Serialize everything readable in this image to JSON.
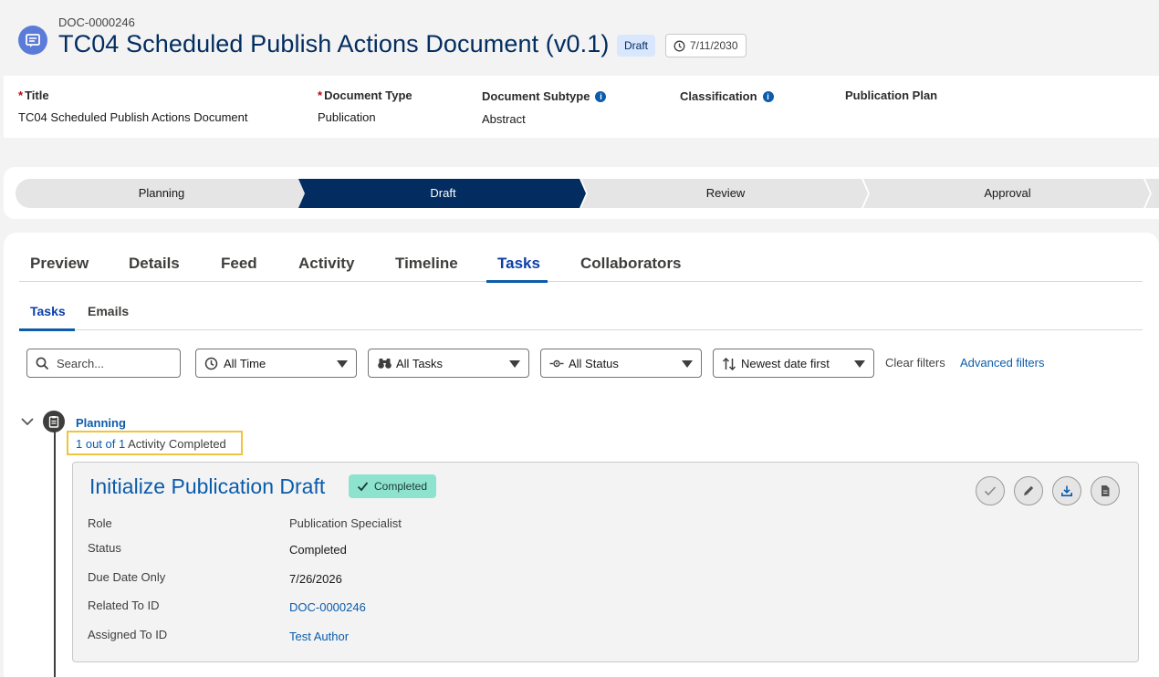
{
  "header": {
    "doc_id": "DOC-0000246",
    "title": "TC04 Scheduled Publish Actions Document (v0.1)",
    "status_badge": "Draft",
    "date_badge": "7/11/2030"
  },
  "fields": [
    {
      "label": "Title",
      "required": true,
      "value": "TC04 Scheduled Publish Actions Document",
      "info": false
    },
    {
      "label": "Document Type",
      "required": true,
      "value": "Publication",
      "info": false
    },
    {
      "label": "Document Subtype",
      "required": false,
      "value": "Abstract",
      "info": true
    },
    {
      "label": "Classification",
      "required": false,
      "value": "",
      "info": true
    },
    {
      "label": "Publication Plan",
      "required": false,
      "value": "",
      "info": false
    }
  ],
  "path": {
    "stages": [
      "Planning",
      "Draft",
      "Review",
      "Approval"
    ],
    "current": "Draft"
  },
  "tabs": {
    "items": [
      "Preview",
      "Details",
      "Feed",
      "Activity",
      "Timeline",
      "Tasks",
      "Collaborators"
    ],
    "active": "Tasks"
  },
  "subtabs": {
    "items": [
      "Tasks",
      "Emails"
    ],
    "active": "Tasks"
  },
  "filters": {
    "search_placeholder": "Search...",
    "time": "All Time",
    "type": "All Tasks",
    "status": "All Status",
    "sort": "Newest date first",
    "clear": "Clear filters",
    "advanced": "Advanced filters"
  },
  "group": {
    "title": "Planning",
    "progress_count": "1 out of 1",
    "progress_text": "Activity Completed"
  },
  "task": {
    "title": "Initialize Publication Draft",
    "status_badge": "Completed",
    "rows": [
      {
        "label": "Role",
        "value": "Publication Specialist"
      },
      {
        "label": "Status",
        "value": "Completed"
      },
      {
        "label": "Due Date Only",
        "value": "7/26/2026"
      },
      {
        "label": "Related To ID",
        "value": "DOC-0000246"
      },
      {
        "label": "Assigned To ID",
        "value": "Test Author"
      }
    ]
  },
  "colors": {
    "brand_navy": "#032d60",
    "link_blue": "#0b5cab",
    "highlight": "#f0c43b",
    "completed_green": "#8ee3cf"
  }
}
